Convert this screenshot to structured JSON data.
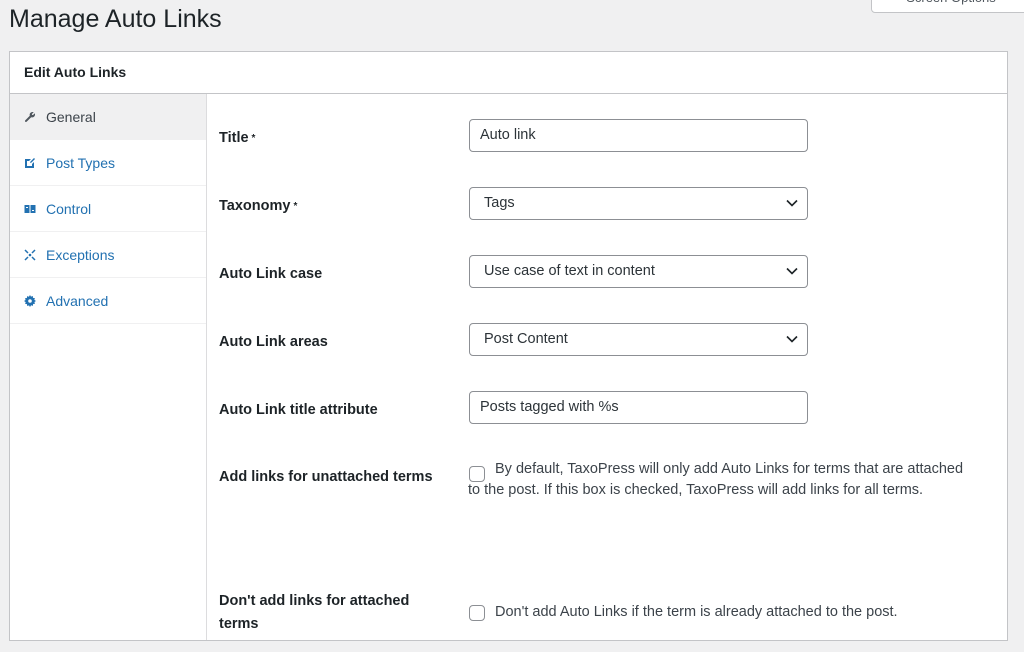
{
  "page": {
    "title": "Manage Auto Links",
    "screen_options": "Screen Options"
  },
  "panel": {
    "title": "Edit Auto Links"
  },
  "tabs": [
    {
      "label": "General",
      "icon": "wrench-icon",
      "active": true
    },
    {
      "label": "Post Types",
      "icon": "post-icon",
      "active": false
    },
    {
      "label": "Control",
      "icon": "control-icon",
      "active": false
    },
    {
      "label": "Exceptions",
      "icon": "exceptions-icon",
      "active": false
    },
    {
      "label": "Advanced",
      "icon": "gear-icon",
      "active": false
    }
  ],
  "form": {
    "title": {
      "label": "Title",
      "required": "*",
      "value": "Auto link"
    },
    "taxonomy": {
      "label": "Taxonomy",
      "required": "*",
      "value": "Tags"
    },
    "case": {
      "label": "Auto Link case",
      "value": "Use case of text in content"
    },
    "areas": {
      "label": "Auto Link areas",
      "value": "Post Content"
    },
    "title_attr": {
      "label": "Auto Link title attribute",
      "value": "Posts tagged with %s"
    },
    "unattached": {
      "label": "Add links for unattached terms",
      "text": "By default, TaxoPress will only add Auto Links for terms that are attached to the post. If this box is checked, TaxoPress will add links for all terms.",
      "checked": false
    },
    "attached": {
      "label": "Don't add links for attached terms",
      "text": "Don't add Auto Links if the term is already attached to the post.",
      "checked": false
    }
  },
  "colors": {
    "link": "#2271b1",
    "active_tab_bg": "#f0f0f1",
    "page_bg": "#f0f0f1"
  }
}
